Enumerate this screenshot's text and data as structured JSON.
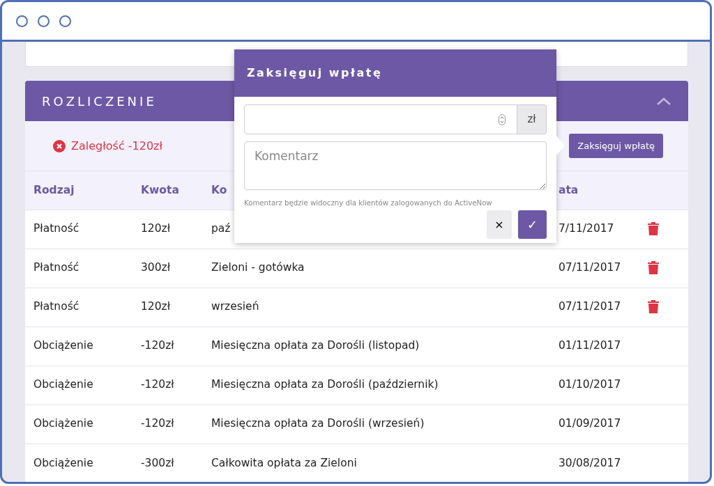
{
  "panel": {
    "title": "ROZLICZENIE",
    "expanded": true
  },
  "alert": {
    "kind": "error",
    "text": "Zaległość -120zł"
  },
  "action_button": "Zaksięguj wpłatę",
  "table": {
    "columns": [
      "Rodzaj",
      "Kwota",
      "Ko",
      "ata"
    ],
    "rows": [
      {
        "cells": [
          "Płatność",
          "120zł",
          "paź",
          "7/11/2017"
        ],
        "deletable": true
      },
      {
        "cells": [
          "Płatność",
          "300zł",
          "Zieloni - gotówka",
          "07/11/2017"
        ],
        "deletable": true
      },
      {
        "cells": [
          "Płatność",
          "120zł",
          "wrzesień",
          "07/11/2017"
        ],
        "deletable": true
      },
      {
        "cells": [
          "Obciążenie",
          "-120zł",
          "Miesięczna opłata za Dorośli (listopad)",
          "01/11/2017"
        ],
        "deletable": false
      },
      {
        "cells": [
          "Obciążenie",
          "-120zł",
          "Miesięczna opłata za Dorośli (październik)",
          "01/10/2017"
        ],
        "deletable": false
      },
      {
        "cells": [
          "Obciążenie",
          "-120zł",
          "Miesięczna opłata za Dorośli (wrzesień)",
          "01/09/2017"
        ],
        "deletable": false
      },
      {
        "cells": [
          "Obciążenie",
          "-300zł",
          "Całkowita opłata za Zieloni",
          "30/08/2017"
        ],
        "deletable": false
      }
    ]
  },
  "popover": {
    "title": "Zaksięguj wpłatę",
    "unit": "zł",
    "comment_placeholder": "Komentarz",
    "help": "Komentarz będzie widoczny dla klientów zalogowanych do ActiveNow",
    "cancel": "×",
    "confirm": "✓"
  }
}
